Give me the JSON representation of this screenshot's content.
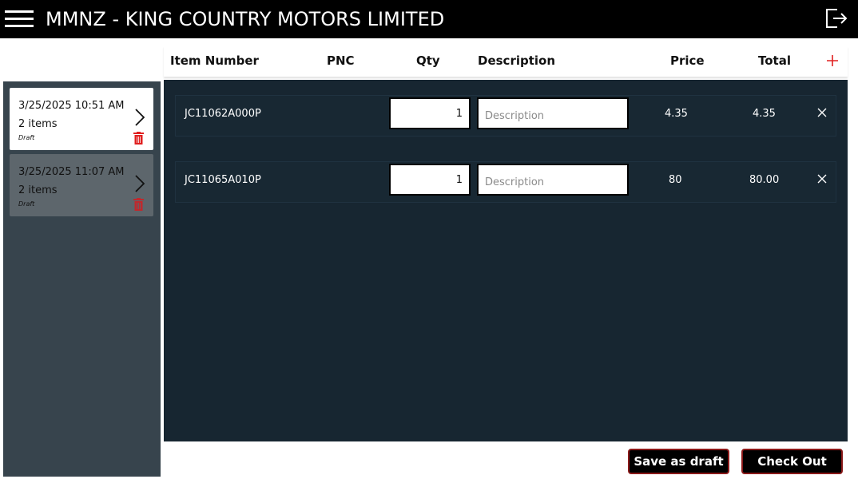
{
  "app": {
    "title": "MMNZ - KING COUNTRY MOTORS LIMITED"
  },
  "icons": {
    "menu": "hamburger-icon",
    "exit": "exit-icon",
    "add": "plus-icon",
    "remove": "close-icon",
    "open": "chevron-right-icon",
    "delete": "trash-icon"
  },
  "colors": {
    "titlebar": "#000000",
    "sidebar": "#37444d",
    "grid": "#172631",
    "accent": "#e02020",
    "button_border": "#8b1a1a"
  },
  "orders": [
    {
      "date": "3/25/2025 10:51 AM",
      "count": "2 items",
      "status": "Draft",
      "selected": true
    },
    {
      "date": "3/25/2025 11:07 AM",
      "count": "2 items",
      "status": "Draft",
      "selected": false
    }
  ],
  "table": {
    "headers": {
      "item_number": "Item Number",
      "pnc": "PNC",
      "qty": "Qty",
      "description": "Description",
      "price": "Price",
      "total": "Total"
    },
    "rows": [
      {
        "item_number": "JC11062A000P",
        "pnc": "",
        "qty": "1",
        "description": "",
        "description_placeholder": "Description",
        "price": "4.35",
        "total": "4.35"
      },
      {
        "item_number": "JC11065A010P",
        "pnc": "",
        "qty": "1",
        "description": "",
        "description_placeholder": "Description",
        "price": "80",
        "total": "80.00"
      }
    ]
  },
  "actions": {
    "save_draft": "Save as draft",
    "checkout": "Check Out"
  }
}
